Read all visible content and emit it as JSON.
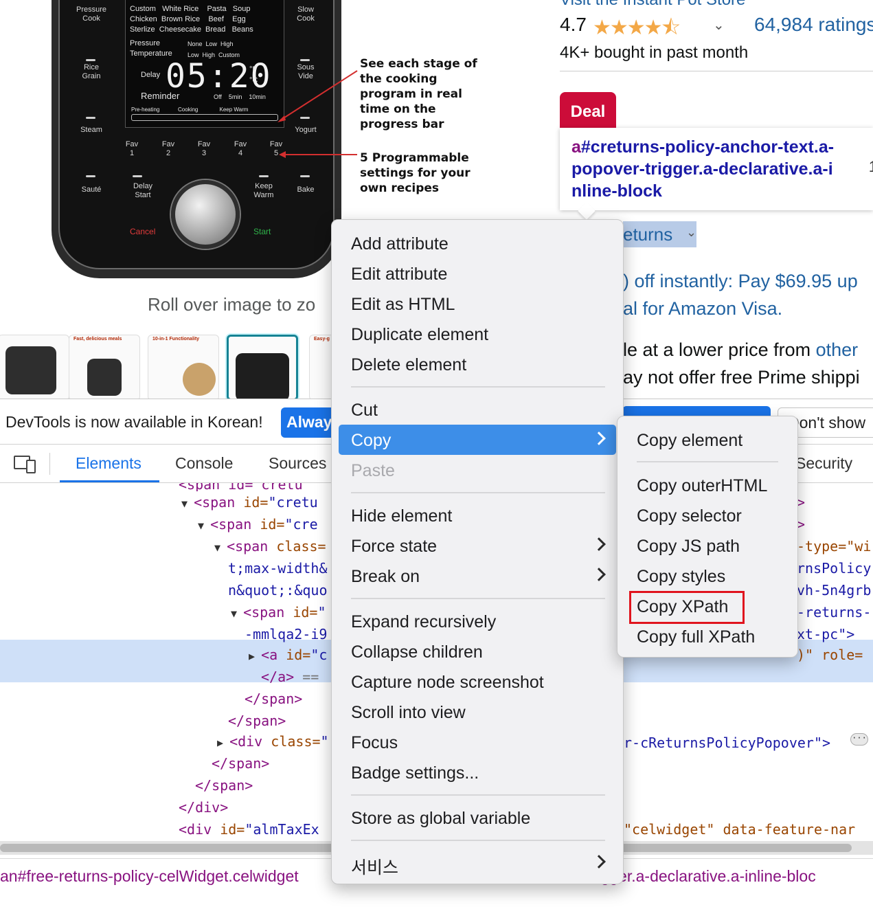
{
  "product": {
    "device": {
      "left_buttons": [
        "Pressure\nCook",
        "Rice\nGrain",
        "Steam",
        "Sauté"
      ],
      "right_buttons": [
        "Slow\nCook",
        "Sous\nVide",
        "Yogurt",
        "Bake"
      ],
      "fav_buttons": [
        "Fav\n1",
        "Fav\n2",
        "Fav\n3",
        "Fav\n4",
        "Fav\n5"
      ],
      "delay_start": "Delay\nStart",
      "keep_warm": "Keep\nWarm",
      "cancel": "Cancel",
      "start": "Start",
      "lcd": {
        "row1": "Custom   White Rice    Pasta   Soup",
        "row2": "Chicken  Brown Rice    Beef    Egg",
        "row3": "Sterlize  Cheesecake  Bread   Beans",
        "pressure": "Pressure",
        "pressure_opts": "None  Low  High",
        "temperature": "Temperature",
        "temperature_opts": "Low  High  Custom",
        "delay": "Delay",
        "time": "05:20",
        "unit_f": "°F",
        "unit_c": "°C",
        "reminder": "Reminder",
        "reminder_opts": "Off    5min    10min",
        "progress_labels": "Pre-heating            Cooking              Keep Warm"
      }
    },
    "callout_1": "See each stage of\nthe cooking\nprogram in real\ntime on the\nprogress bar",
    "callout_2": "5 Programmable\nsettings for your\nown recipes",
    "roll_over": "Roll over image to zo",
    "thumbnails": [
      {
        "caption": ""
      },
      {
        "caption": "Fast, delicious meals"
      },
      {
        "caption": "10-in-1 Functionality"
      },
      {
        "caption": ""
      },
      {
        "caption": "Easy-g"
      }
    ],
    "store_link": "Visit the Instant Pot Store",
    "rating": "4.7",
    "stars": "★★★★",
    "stars_half": "⯪",
    "ratings_count": "64,984 ratings",
    "bought": "4K+ bought in past month",
    "deal_badge": "Deal",
    "tooltip_tag": "a",
    "tooltip_selector": "#creturns-policy-anchor-text.a-popover-trigger.a-declarative.a-i nline-block",
    "tooltip_extra": "1",
    "returns_link": "eturns",
    "offer_line1": ") off instantly: Pay $69.95 up",
    "offer_line2": "al for Amazon Visa.",
    "avail_line1_prefix": "le at a lower price from ",
    "avail_line1_link": "other",
    "avail_line2": "ay not offer free Prime shippi"
  },
  "devtools": {
    "info_text": "DevTools is now available in Korean!",
    "info_always": "Always",
    "info_dont_show": "Don't show",
    "tabs": [
      "Elements",
      "Console",
      "Sources",
      "Security"
    ],
    "dom_top_partial": "<span id=\"cretu",
    "dom_lines": [
      {
        "tri": "▼",
        "tag": "<span",
        "attr": " id=",
        "val": "\"cretu",
        "tail": ""
      },
      {
        "tri": "▼",
        "tag": "<span",
        "attr": " id=",
        "val": "\"cre",
        "tail": ""
      },
      {
        "tri": "▼",
        "tag": "<span",
        "attr": " class=",
        "val": "",
        "tail": ""
      },
      {
        "tri": "",
        "tag": "",
        "attr": "",
        "val": "t;max-width&",
        "tail": ""
      },
      {
        "tri": "",
        "tag": "",
        "attr": "",
        "val": "n&quot;:&quo",
        "tail": ""
      },
      {
        "tri": "▼",
        "tag": "<span",
        "attr": " id=",
        "val": "\"",
        "tail": ""
      },
      {
        "tri": "",
        "tag": "",
        "attr": "",
        "val": "-mmlqa2-i9",
        "tail": ""
      },
      {
        "tri": "▶",
        "tag": "<a",
        "attr": " id=",
        "val": "\"c",
        "tail": ""
      },
      {
        "tri": "",
        "tag": "</a>",
        "attr": "",
        "val": "",
        "tail": " =="
      },
      {
        "tri": "",
        "tag": "</span>",
        "attr": "",
        "val": "",
        "tail": ""
      },
      {
        "tri": "",
        "tag": "</span>",
        "attr": "",
        "val": "",
        "tail": ""
      },
      {
        "tri": "▶",
        "tag": "<div",
        "attr": " class=",
        "val": "\"",
        "tail": ""
      },
      {
        "tri": "",
        "tag": "</span>",
        "attr": "",
        "val": "",
        "tail": ""
      },
      {
        "tri": "",
        "tag": "</span>",
        "attr": "",
        "val": "",
        "tail": ""
      },
      {
        "tri": "",
        "tag": "</div>",
        "attr": "",
        "val": "",
        "tail": ""
      },
      {
        "tri": "",
        "tag": "<div",
        "attr": " id=",
        "val": "\"almTaxEx",
        "tail": ""
      }
    ],
    "dom_right": [
      {
        "text": ">",
        "kind": "tag"
      },
      {
        "text": ">",
        "kind": "tag"
      },
      {
        "text": "-type=\"wi",
        "kind": "mixed"
      },
      {
        "text": "rnsPolicy",
        "kind": "val"
      },
      {
        "text": "vh-5n4grb",
        "kind": "val"
      },
      {
        "text": "-returns-",
        "kind": "val"
      },
      {
        "text": "xt-pc\">",
        "kind": "val"
      },
      {
        "text": ")\" role=",
        "kind": "mixed"
      },
      {
        "text": "r-cReturnsPolicyPopover\">",
        "kind": "val"
      },
      {
        "text": "\"celwidget\" data-feature-nar",
        "kind": "mixed"
      }
    ],
    "ellipsis": "···",
    "crumb_left": "an#free-returns-policy-celWidget.celwidget",
    "crumb_right": "r-trigger.a-declarative.a-inline-bloc"
  },
  "context_menu": {
    "items": [
      {
        "label": "Add attribute"
      },
      {
        "label": "Edit attribute"
      },
      {
        "label": "Edit as HTML"
      },
      {
        "label": "Duplicate element"
      },
      {
        "label": "Delete element"
      },
      {
        "label": "Cut"
      },
      {
        "label": "Copy"
      },
      {
        "label": "Paste"
      },
      {
        "label": "Hide element"
      },
      {
        "label": "Force state"
      },
      {
        "label": "Break on"
      },
      {
        "label": "Expand recursively"
      },
      {
        "label": "Collapse children"
      },
      {
        "label": "Capture node screenshot"
      },
      {
        "label": "Scroll into view"
      },
      {
        "label": "Focus"
      },
      {
        "label": "Badge settings..."
      },
      {
        "label": "Store as global variable"
      },
      {
        "label": "서비스"
      }
    ]
  },
  "copy_submenu": {
    "items": [
      {
        "label": "Copy element"
      },
      {
        "label": "Copy outerHTML"
      },
      {
        "label": "Copy selector"
      },
      {
        "label": "Copy JS path"
      },
      {
        "label": "Copy styles"
      },
      {
        "label": "Copy XPath"
      },
      {
        "label": "Copy full XPath"
      }
    ],
    "highlighted": "Copy XPath",
    "highlight_color": "#e0141e"
  },
  "colors": {
    "accent": "#1a73e8",
    "menu_active": "#3d8ee8",
    "deal": "#cc0c39",
    "link": "#2162a1",
    "star": "#f3a847"
  }
}
